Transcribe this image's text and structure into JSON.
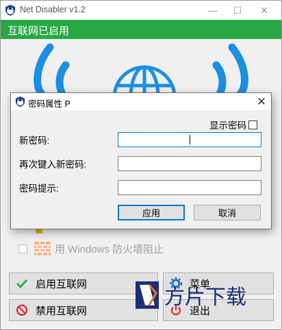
{
  "main": {
    "title": "Net Disabler v1.2",
    "status": "互联网已启用",
    "firewall_checkbox_label": "用 Windows 防火墙阻止",
    "buttons": {
      "enable": "启用互联网",
      "disable": "禁用互联网",
      "menu": "菜单",
      "exit": "退出"
    },
    "window_controls": {
      "minimize": "—",
      "maximize": "☐",
      "close": "✕"
    }
  },
  "dialog": {
    "title": "密码属性 P",
    "close": "✕",
    "show_password_label": "显示密码",
    "fields": {
      "new_password_label": "新密码:",
      "confirm_password_label": "再次键入新密码:",
      "hint_label": "密码提示:"
    },
    "apply_label": "应用",
    "cancel_label": "取消"
  },
  "watermark": {
    "text": "方片下载"
  },
  "colors": {
    "status_bg": "#27a844",
    "graphic_blue": "#1a8fe3",
    "accent": "#0078d7",
    "enable_icon": "#2fa84f",
    "disable_icon": "#e0262e"
  },
  "icons": {
    "app": "shield-plug-icon",
    "enable": "check-icon",
    "disable": "prohibited-icon",
    "menu": "gear-icon",
    "exit": "power-icon",
    "firewall": "brick-wall-icon"
  }
}
